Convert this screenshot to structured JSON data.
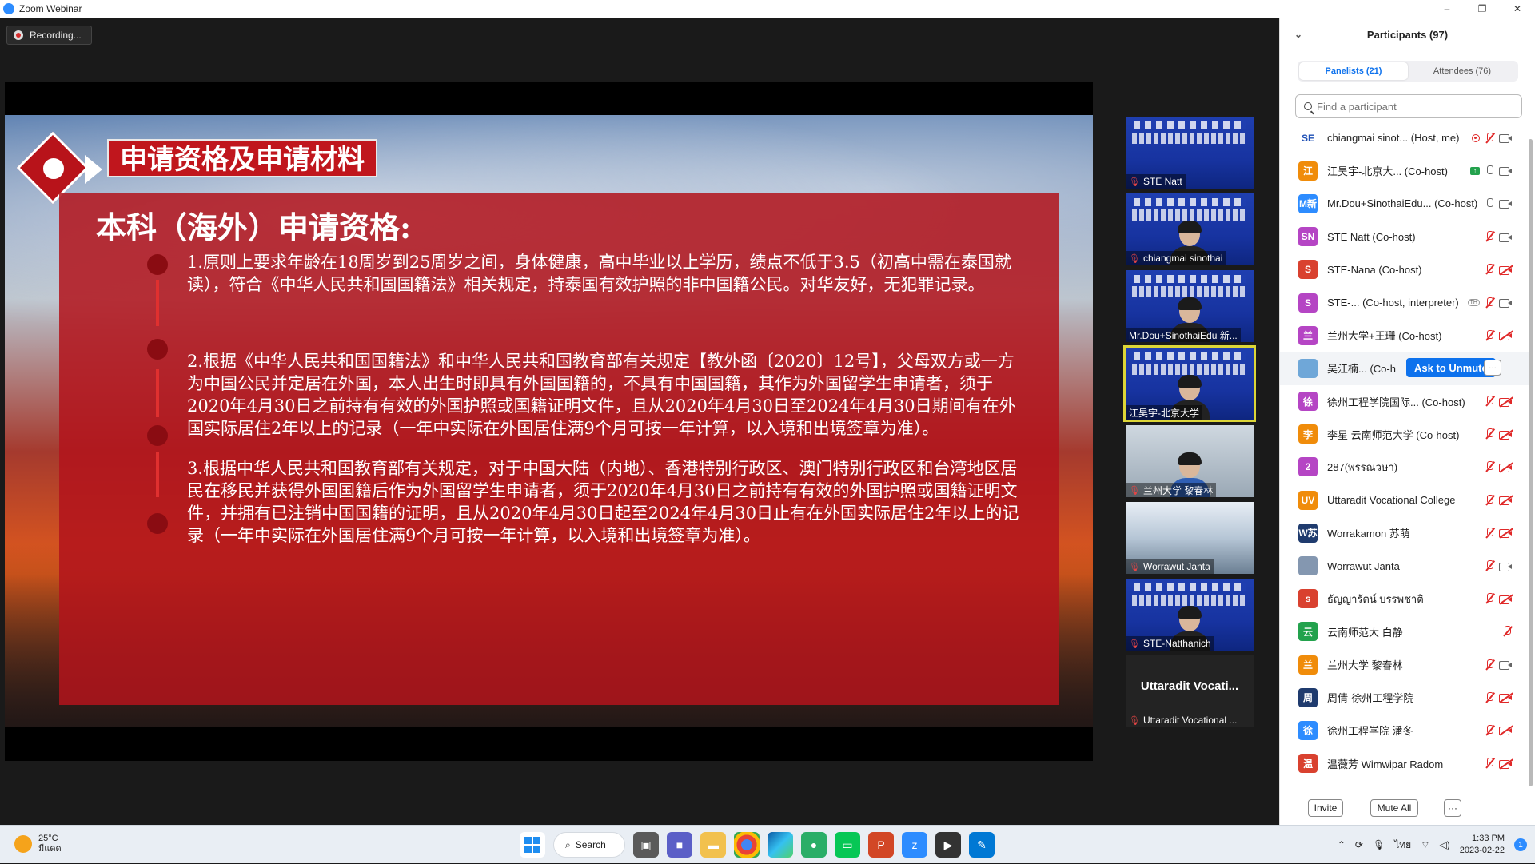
{
  "window": {
    "title": "Zoom Webinar",
    "controls": [
      "–",
      "❐",
      "✕"
    ]
  },
  "recording": {
    "label": "Recording..."
  },
  "slide": {
    "heading": "申请资格及申请材料",
    "panel_title": "本科（海外）申请资格:",
    "items": [
      "1.原则上要求年龄在18周岁到25周岁之间，身体健康，高中毕业以上学历，绩点不低于3.5（初高中需在泰国就读），符合《中华人民共和国国籍法》相关规定，持泰国有效护照的非中国籍公民。对华友好，无犯罪记录。",
      "2.根据《中华人民共和国国籍法》和中华人民共和国教育部有关规定【教外函〔2020〕12号】，父母双方或一方为中国公民并定居在外国，本人出生时即具有外国国籍的，不具有中国国籍，其作为外国留学生申请者，须于2020年4月30日之前持有有效的外国护照或国籍证明文件，且从2020年4月30日至2024年4月30日期间有在外国实际居住2年以上的记录（一年中实际在外国居住满9个月可按一年计算，以入境和出境签章为准）。",
      "3.根据中华人民共和国教育部有关规定，对于中国大陆（内地）、香港特别行政区、澳门特别行政区和台湾地区居民在移民并获得外国国籍后作为外国留学生申请者，须于2020年4月30日之前持有有效的外国护照或国籍证明文件，并拥有已注销中国国籍的证明，且从2020年4月30日起至2024年4月30日止有在外国实际居住2年以上的记录（一年中实际在外国居住满9个月可按一年计算，以入境和出境签章为准）。"
    ]
  },
  "thumbnails": [
    {
      "name": "STE Natt",
      "kind": "poster"
    },
    {
      "name": "chiangmai sinothai",
      "kind": "poster-person"
    },
    {
      "name": "Mr.Dou+SinothaiEdu 新...",
      "kind": "poster-person"
    },
    {
      "name": "江昊宇-北京大学",
      "kind": "poster-person",
      "active": true
    },
    {
      "name": "兰州大学 黎春林",
      "kind": "room"
    },
    {
      "name": "Worrawut Janta",
      "kind": "room2"
    },
    {
      "name": "STE-Natthanich",
      "kind": "poster-person"
    },
    {
      "name": "Uttaradit Vocational ...",
      "kind": "blank",
      "big_name": "Uttaradit Vocati..."
    }
  ],
  "participants_panel": {
    "title": "Participants (97)",
    "tabs": {
      "panelists": "Panelists (21)",
      "attendees": "Attendees (76)"
    },
    "search_placeholder": "Find a participant",
    "invite_label": "Invite",
    "mute_all_label": "Mute All",
    "more_label": "···",
    "ask_to_unmute_label": "Ask to Unmute",
    "rows": [
      {
        "avatar": "SE",
        "color": "#ffffff",
        "text_color": "#1e4fb5",
        "name": "chiangmai sinot...",
        "role": "(Host, me)",
        "mic": "off",
        "cam": "on",
        "rec": true
      },
      {
        "avatar": "江",
        "color": "#f08c0a",
        "name": "江昊宇-北京大...",
        "role": "(Co-host)",
        "mic": "on",
        "cam": "on",
        "share": true
      },
      {
        "avatar": "M新",
        "color": "#2d8cff",
        "name": "Mr.Dou+SinothaiEdu...",
        "role": "(Co-host)",
        "mic": "on",
        "cam": "on"
      },
      {
        "avatar": "SN",
        "color": "#b545c4",
        "name": "STE Natt",
        "role": "(Co-host)",
        "mic": "off",
        "cam": "on"
      },
      {
        "avatar": "S",
        "color": "#d9412f",
        "name": "STE-Nana",
        "role": "(Co-host)",
        "mic": "off",
        "cam": "off"
      },
      {
        "avatar": "S",
        "color": "#b545c4",
        "name": "STE-...",
        "role": "(Co-host, interpreter)",
        "mic": "off",
        "cam": "on",
        "th": "TH"
      },
      {
        "avatar": "兰",
        "color": "#b545c4",
        "name": "兰州大学+王珊",
        "role": "(Co-host)",
        "mic": "off",
        "cam": "off"
      },
      {
        "avatar": "",
        "color": "#6fa7d8",
        "name": "吴江楠...",
        "role": "(Co-h",
        "mic": "",
        "cam": "",
        "highlight": true,
        "ask": true
      },
      {
        "avatar": "徐",
        "color": "#b545c4",
        "name": "徐州工程学院国际...",
        "role": "(Co-host)",
        "mic": "off",
        "cam": "off"
      },
      {
        "avatar": "李",
        "color": "#f08c0a",
        "name": "李星 云南师范大学",
        "role": "(Co-host)",
        "mic": "off",
        "cam": "off"
      },
      {
        "avatar": "2",
        "color": "#b545c4",
        "name": "287(พรรณวษา)",
        "role": "",
        "mic": "off",
        "cam": "off"
      },
      {
        "avatar": "UV",
        "color": "#f08c0a",
        "name": "Uttaradit Vocational College",
        "role": "",
        "mic": "off",
        "cam": "off"
      },
      {
        "avatar": "W苏",
        "color": "#1f3b6e",
        "name": "Worrakamon 苏萌",
        "role": "",
        "mic": "off",
        "cam": "off"
      },
      {
        "avatar": "",
        "color": "#8497b0",
        "name": "Worrawut Janta",
        "role": "",
        "mic": "off",
        "cam": "on"
      },
      {
        "avatar": "s",
        "color": "#d9412f",
        "name": "ธัญญารัตน์ บรรพชาติ",
        "role": "",
        "mic": "off",
        "cam": "off"
      },
      {
        "avatar": "云",
        "color": "#23a24d",
        "name": "云南师范大 白静",
        "role": "",
        "mic": "off",
        "cam": ""
      },
      {
        "avatar": "兰",
        "color": "#f08c0a",
        "name": "兰州大学 黎春林",
        "role": "",
        "mic": "off",
        "cam": "on"
      },
      {
        "avatar": "周",
        "color": "#1f3b6e",
        "name": "周倩-徐州工程学院",
        "role": "",
        "mic": "off",
        "cam": "off"
      },
      {
        "avatar": "徐",
        "color": "#2d8cff",
        "name": "徐州工程学院 潘冬",
        "role": "",
        "mic": "off",
        "cam": "off"
      },
      {
        "avatar": "温",
        "color": "#d9412f",
        "name": "温薇芳 Wimwipar Radom",
        "role": "",
        "mic": "off",
        "cam": "off"
      }
    ]
  },
  "taskbar": {
    "weather_temp": "25°C",
    "weather_desc": "มีแดด",
    "search_label": "Search",
    "lang": "ไทย",
    "time": "1:33 PM",
    "date": "2023-02-22",
    "notifications": "1"
  }
}
